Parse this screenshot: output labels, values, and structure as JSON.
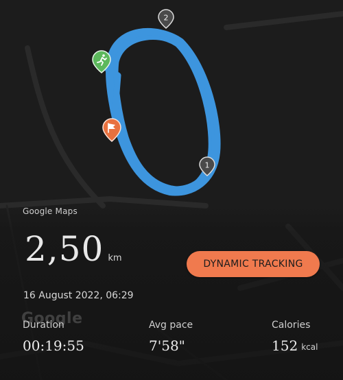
{
  "map": {
    "attribution": "Google Maps",
    "watermark": "Google",
    "route_color": "#3d95de",
    "background_color": "#1c1c1c",
    "markers": {
      "start_icon": "running-person-icon",
      "start_color": "#5cb85c",
      "finish_icon": "finish-flag-icon",
      "finish_color": "#e8713f",
      "lap_1": "1",
      "lap_2": "2"
    }
  },
  "summary": {
    "distance_value": "2,50",
    "distance_unit": "km",
    "date": "16 August 2022, 06:29"
  },
  "tracking_button": {
    "label": "DYNAMIC TRACKING",
    "color": "#f07a4e"
  },
  "stats": {
    "duration": {
      "label": "Duration",
      "value": "00:19:55",
      "unit": ""
    },
    "avg_pace": {
      "label": "Avg pace",
      "value": "7'58\"",
      "unit": ""
    },
    "calories": {
      "label": "Calories",
      "value": "152",
      "unit": "kcal"
    }
  }
}
